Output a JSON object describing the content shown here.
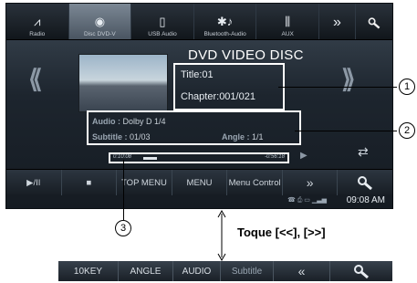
{
  "sources": [
    {
      "label": "Radio",
      "icon": "radio-antenna-icon"
    },
    {
      "label": "Disc DVD-V",
      "icon": "disc-icon"
    },
    {
      "label": "USB Audio",
      "icon": "usb-icon"
    },
    {
      "label": "Bluetooth-Audio",
      "icon": "bluetooth-icon"
    },
    {
      "label": "AUX",
      "icon": "aux-icon"
    }
  ],
  "source_more": "»",
  "header": {
    "title": "DVD VIDEO DISC"
  },
  "disc": {
    "title_label": "Title:01",
    "chapter_label": "Chapter:001/021"
  },
  "audio": {
    "audio_key": "Audio :",
    "audio_val": "Dolby D 1/4",
    "subtitle_key": "Subtitle :",
    "subtitle_val": "01/03",
    "angle_key": "Angle :",
    "angle_val": "1/1"
  },
  "playback": {
    "elapsed": "0:10:08",
    "remaining": "-0:56:18",
    "progress": 0.14
  },
  "controls": {
    "play_pause": "▶/II",
    "stop": "■",
    "top_menu": "TOP MENU",
    "menu": "MENU",
    "menu_control": "Menu Control",
    "more": "»"
  },
  "status": {
    "time": "09:08 AM"
  },
  "callouts": {
    "one": "1",
    "two": "2",
    "three": "3"
  },
  "annotation": {
    "toque": "Toque [<<], [>>]"
  },
  "bottom_bar": {
    "k10": "10KEY",
    "angle": "ANGLE",
    "audio": "AUDIO",
    "subtitle": "Subtitle",
    "back": "«"
  }
}
